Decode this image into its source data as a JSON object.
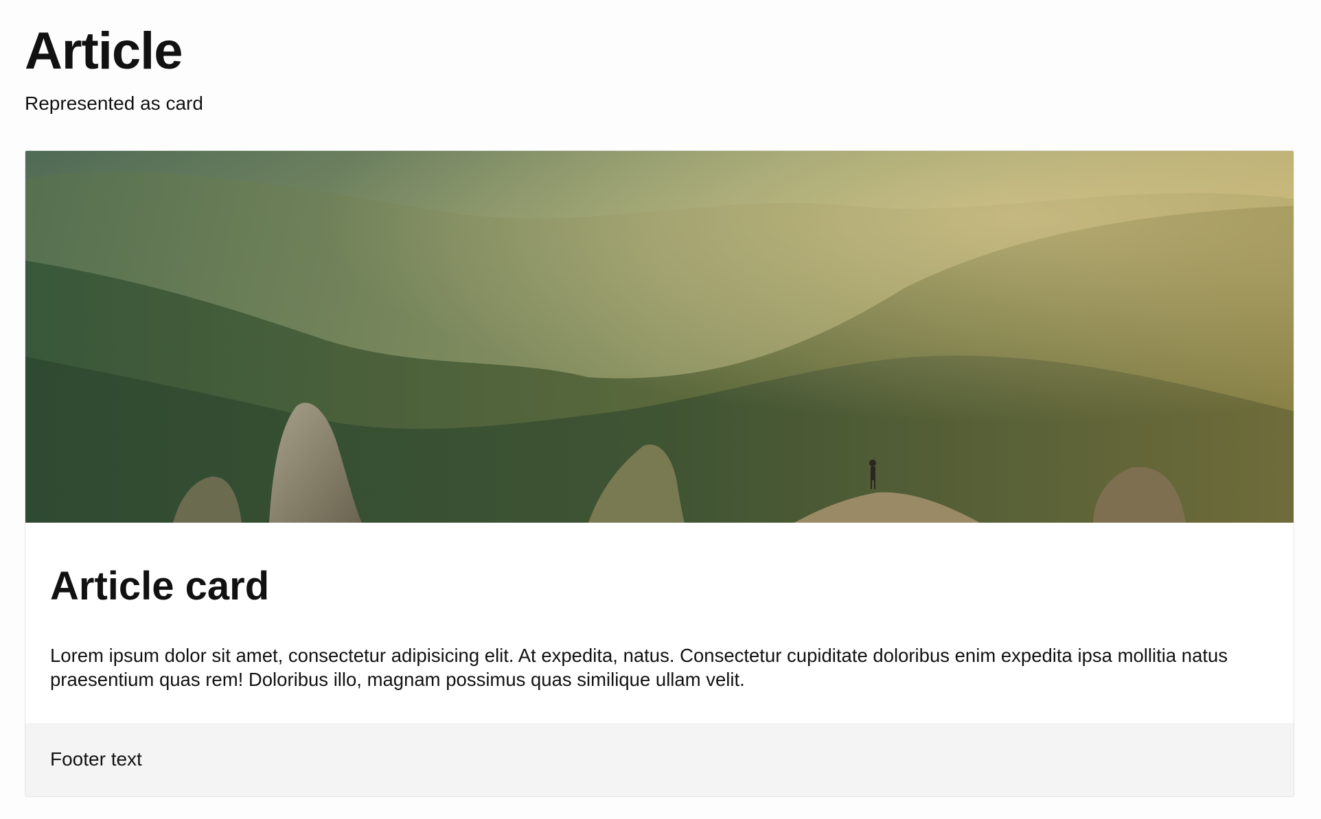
{
  "page": {
    "title": "Article",
    "subtitle": "Represented as card"
  },
  "card": {
    "image_alt": "Hiker standing on a rocky peak overlooking forested mountains at sunrise",
    "title": "Article card",
    "text": "Lorem ipsum dolor sit amet, consectetur adipisicing elit. At expedita, natus. Consectetur cupiditate doloribus enim expedita ipsa mollitia natus praesentium quas rem! Doloribus illo, magnam possimus quas similique ullam velit.",
    "footer": "Footer text"
  },
  "colors": {
    "page_background": "#fdfdfd",
    "card_background": "#ffffff",
    "footer_background": "#f4f4f4",
    "card_border": "#e4e4e4"
  }
}
